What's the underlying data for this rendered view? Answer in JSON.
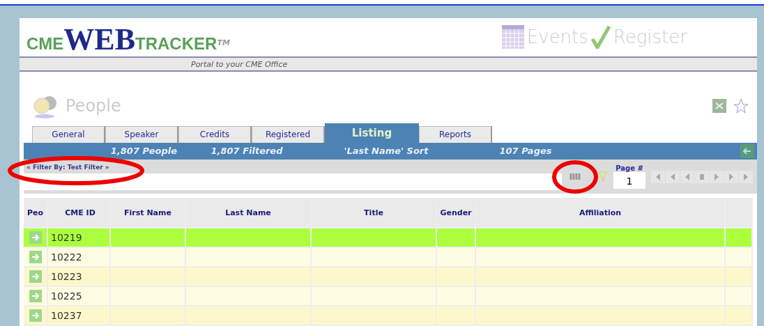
{
  "header": {
    "logo": {
      "left": "CME",
      "middle": "WEB",
      "right": "TRACKER",
      "mark": "TM"
    },
    "tagline": "Portal to your CME Office",
    "links": [
      {
        "kind": "calendar",
        "label": "Events"
      },
      {
        "kind": "check",
        "label": "Register"
      }
    ]
  },
  "section": {
    "title": "People"
  },
  "tabs": [
    {
      "label": "General",
      "selected": false
    },
    {
      "label": "Speaker",
      "selected": false
    },
    {
      "label": "Credits",
      "selected": false
    },
    {
      "label": "Registered",
      "selected": false
    },
    {
      "label": "Listing",
      "selected": true
    },
    {
      "label": "Reports",
      "selected": false
    }
  ],
  "summary": [
    "1,807 People",
    "1,807 Filtered",
    "'Last Name' Sort",
    "107 Pages"
  ],
  "filter": {
    "label": "« Filter By: Test Filter »",
    "page_label": "Page #",
    "page": "1"
  },
  "table": {
    "columns": [
      "Peo",
      "CME ID",
      "First Name",
      "Last Name",
      "Title",
      "Gender",
      "Affiliation"
    ],
    "rows": [
      {
        "id": "10219",
        "selected": true
      },
      {
        "id": "10222",
        "selected": false
      },
      {
        "id": "10223",
        "selected": false
      },
      {
        "id": "10225",
        "selected": false
      },
      {
        "id": "10237",
        "selected": false
      }
    ]
  }
}
